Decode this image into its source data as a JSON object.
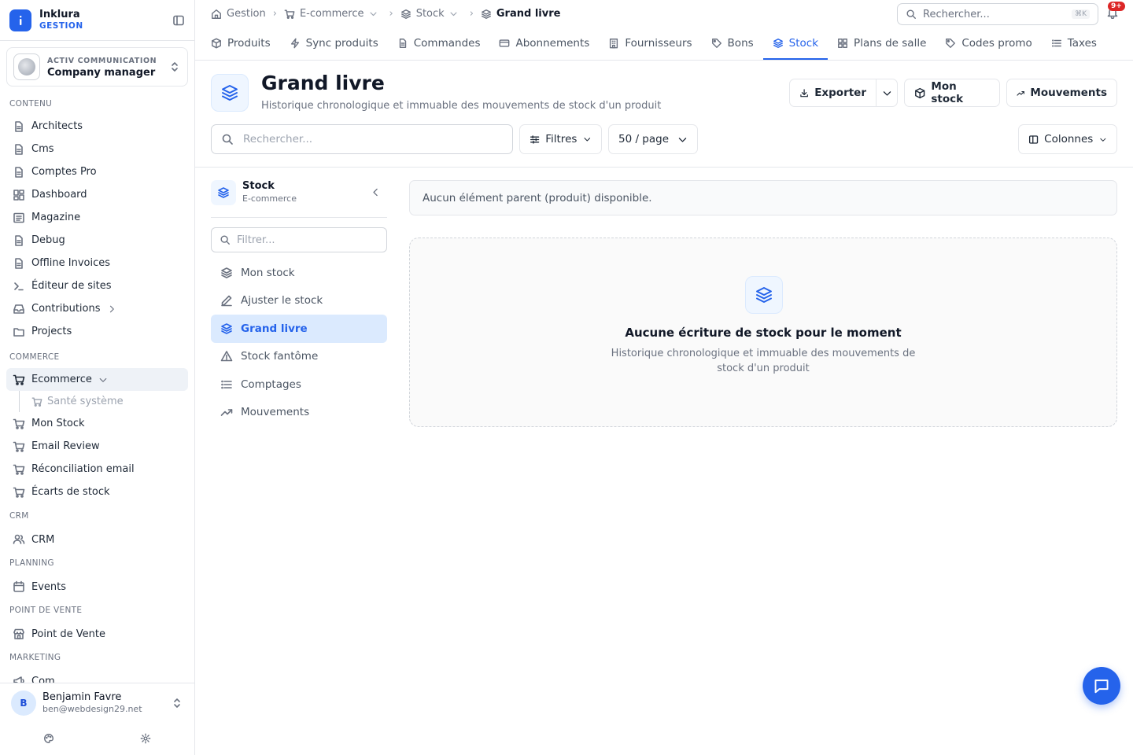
{
  "brand": {
    "name": "Inklura",
    "sub": "GESTION"
  },
  "org": {
    "sub": "ACTIV COMMUNICATION",
    "name": "Company manager"
  },
  "sidebar": {
    "sections": {
      "contenu": "CONTENU",
      "commerce": "COMMERCE",
      "crm": "CRM",
      "planning": "PLANNING",
      "pos": "POINT DE VENTE",
      "marketing": "MARKETING"
    },
    "items": {
      "architects": "Architects",
      "cms": "Cms",
      "comptes_pro": "Comptes Pro",
      "dashboard": "Dashboard",
      "magazine": "Magazine",
      "debug": "Debug",
      "offline_invoices": "Offline Invoices",
      "editeur": "Éditeur de sites",
      "contributions": "Contributions",
      "projects": "Projects",
      "ecommerce": "Ecommerce",
      "sante": "Santé système",
      "mon_stock": "Mon Stock",
      "email_review": "Email Review",
      "reconciliation": "Réconciliation email",
      "ecarts": "Écarts de stock",
      "crm": "CRM",
      "events": "Events",
      "pdv": "Point de Vente",
      "com": "Com"
    }
  },
  "user": {
    "initial": "B",
    "name": "Benjamin Favre",
    "email": "ben@webdesign29.net"
  },
  "breadcrumb": {
    "gestion": "Gestion",
    "ecommerce": "E-commerce",
    "stock": "Stock",
    "current": "Grand livre"
  },
  "topsearch": {
    "placeholder": "Rechercher...",
    "shortcut": "⌘K"
  },
  "notifications": {
    "badge": "9+"
  },
  "tabs": {
    "produits": "Produits",
    "sync": "Sync produits",
    "commandes": "Commandes",
    "abonnements": "Abonnements",
    "fournisseurs": "Fournisseurs",
    "bons": "Bons",
    "stock": "Stock",
    "plans": "Plans de salle",
    "codes": "Codes promo",
    "taxes": "Taxes"
  },
  "header": {
    "title": "Grand livre",
    "subtitle": "Historique chronologique et immuable des mouvements de stock d'un produit",
    "export_label": "Exporter",
    "mon_stock_label": "Mon stock",
    "mouvements_label": "Mouvements"
  },
  "toolbar": {
    "search_placeholder": "Rechercher...",
    "filters_label": "Filtres",
    "per_page": "50 / page",
    "columns_label": "Colonnes"
  },
  "subnav": {
    "title": "Stock",
    "subtitle": "E-commerce",
    "filter_placeholder": "Filtrer...",
    "items": {
      "mon_stock": "Mon stock",
      "ajuster": "Ajuster le stock",
      "grand_livre": "Grand livre",
      "fantome": "Stock fantôme",
      "comptages": "Comptages",
      "mouvements": "Mouvements"
    }
  },
  "content": {
    "notice": "Aucun élément parent (produit) disponible.",
    "empty_title": "Aucune écriture de stock pour le moment",
    "empty_desc": "Historique chronologique et immuable des mouvements de stock d'un produit"
  },
  "colors": {
    "accent": "#2563eb",
    "active_bg": "#dbeafe",
    "badge": "#dc2626"
  }
}
